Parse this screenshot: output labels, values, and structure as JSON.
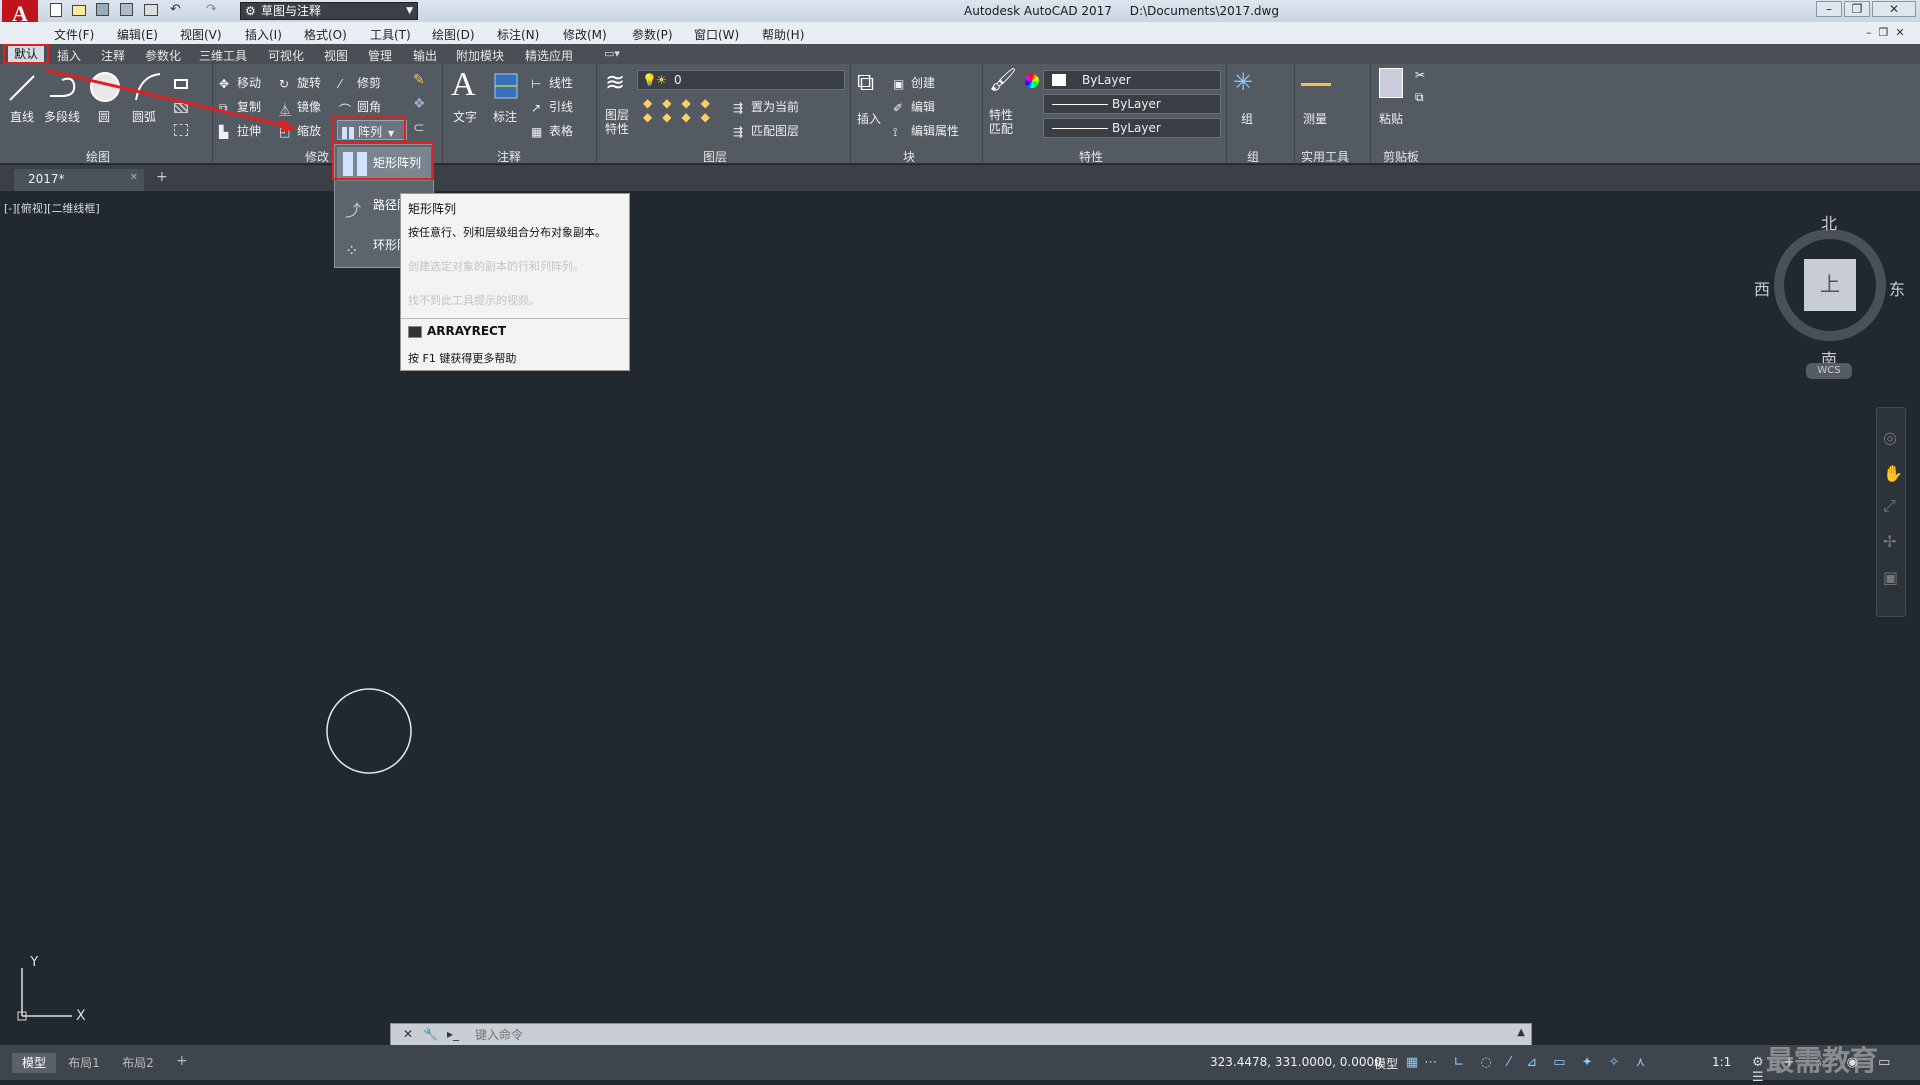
{
  "titlebar": {
    "app_title": "Autodesk AutoCAD 2017",
    "file_path": "D:\\Documents\\2017.dwg",
    "workspace": "草图与注释"
  },
  "menu": [
    "文件(F)",
    "编辑(E)",
    "视图(V)",
    "插入(I)",
    "格式(O)",
    "工具(T)",
    "绘图(D)",
    "标注(N)",
    "修改(M)",
    "参数(P)",
    "窗口(W)",
    "帮助(H)"
  ],
  "ribbon_tabs": [
    "默认",
    "插入",
    "注释",
    "参数化",
    "三维工具",
    "可视化",
    "视图",
    "管理",
    "输出",
    "附加模块",
    "精选应用"
  ],
  "ribbon": {
    "draw": {
      "line": "直线",
      "polyline": "多段线",
      "circle": "圆",
      "arc": "圆弧",
      "panel": "绘图"
    },
    "modify": {
      "move": "移动",
      "rotate": "旋转",
      "trim": "修剪",
      "copy": "复制",
      "mirror": "镜像",
      "fillet": "圆角",
      "stretch": "拉伸",
      "scale": "缩放",
      "array": "阵列",
      "panel": "修改"
    },
    "annotation": {
      "text": "文字",
      "dimension": "标注",
      "linear": "线性",
      "leader": "引线",
      "table": "表格",
      "panel": "注释"
    },
    "layers": {
      "layer_props": "图层\n特性",
      "current_layer": "0",
      "set_current": "置为当前",
      "match_layer": "匹配图层",
      "panel": "图层"
    },
    "block": {
      "insert": "插入",
      "create": "创建",
      "edit": "编辑",
      "edit_attr": "编辑属性",
      "panel": "块"
    },
    "properties": {
      "match": "特性\n匹配",
      "color": "ByLayer",
      "linetype": "ByLayer",
      "lineweight": "ByLayer",
      "panel": "特性"
    },
    "groups": {
      "group": "组",
      "panel": "组"
    },
    "utilities": {
      "measure": "测量",
      "panel": "实用工具"
    },
    "clipboard": {
      "paste": "粘贴",
      "panel": "剪贴板"
    }
  },
  "array_menu": {
    "items": [
      "矩形阵列",
      "路径阵列",
      "环形阵列"
    ]
  },
  "tooltip": {
    "title": "矩形阵列",
    "desc": "按任意行、列和层级组合分布对象副本。",
    "faded1": "创建选定对象的副本的行和列阵列。",
    "faded2": "找不到此工具提示的视频。",
    "command": "ARRAYRECT",
    "help": "按 F1 键获得更多帮助"
  },
  "doc_tab": "2017*",
  "viewport_label": "[-][俯视][二维线框]",
  "viewcube": {
    "north": "北",
    "south": "南",
    "east": "东",
    "west": "西",
    "top": "上",
    "wcs": "WCS"
  },
  "command_placeholder": "键入命令",
  "layout_tabs": [
    "模型",
    "布局1",
    "布局2"
  ],
  "status": {
    "coords": "323.4478, 331.0000, 0.0000",
    "mode": "模型",
    "scale": "1:1"
  },
  "watermark": "最需教育",
  "colors": {
    "accent_red": "#e02020",
    "canvas": "#212830",
    "ribbon": "#545a61"
  }
}
